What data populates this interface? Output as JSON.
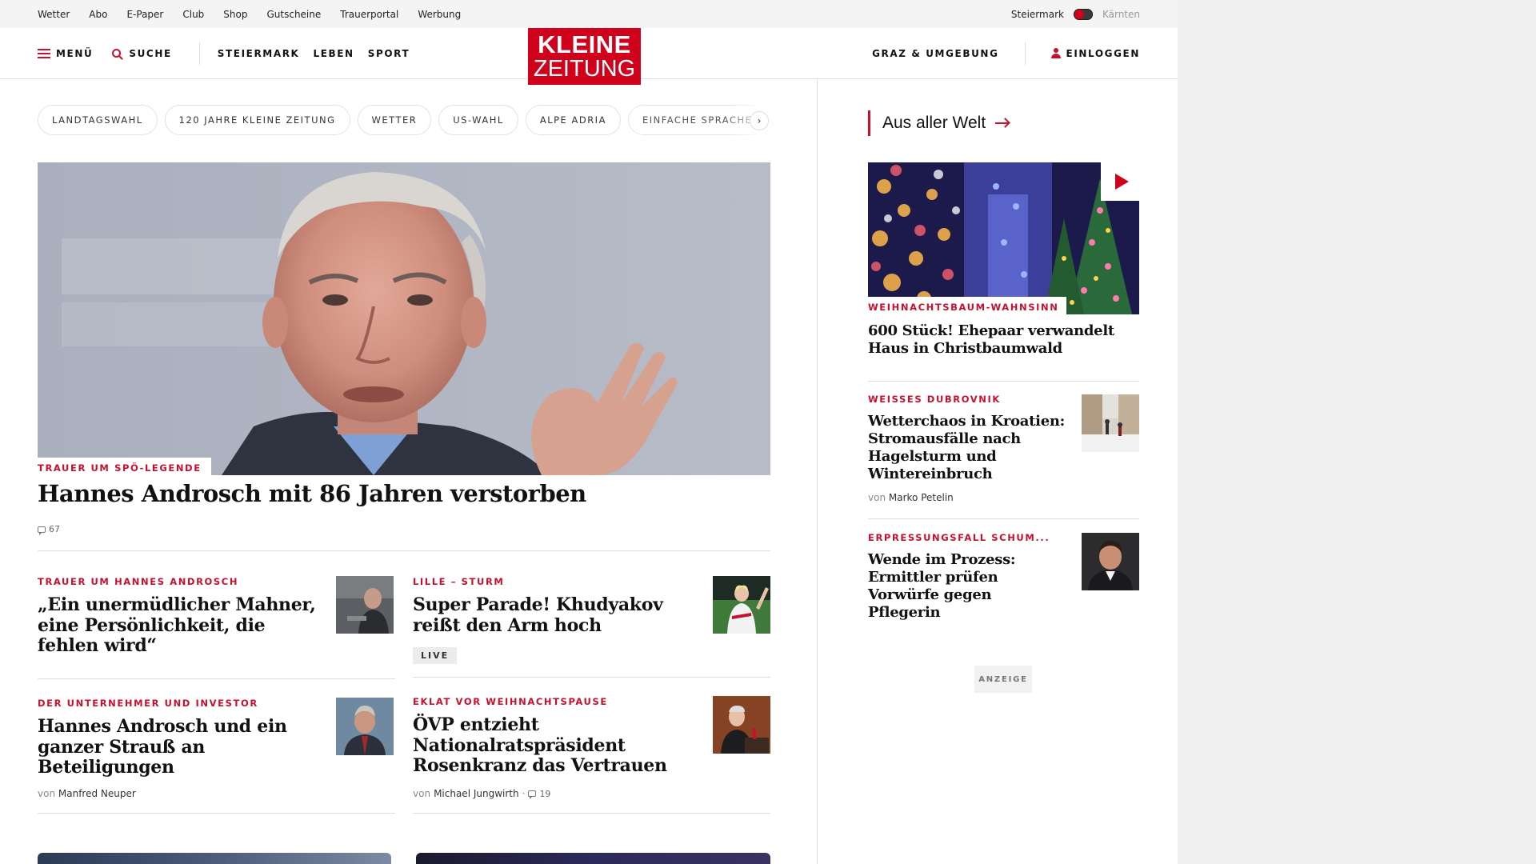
{
  "utility": {
    "links": [
      "Wetter",
      "Abo",
      "E-Paper",
      "Club",
      "Shop",
      "Gutscheine",
      "Trauerportal",
      "Werbung"
    ],
    "region_active": "Steiermark",
    "region_inactive": "Kärnten"
  },
  "nav": {
    "menu": "MENÜ",
    "search": "SUCHE",
    "sections": [
      "STEIERMARK",
      "LEBEN",
      "SPORT"
    ],
    "local": "GRAZ & UMGEBUNG",
    "login": "EINLOGGEN",
    "logo_line1": "KLEINE",
    "logo_line2": "ZEITUNG"
  },
  "chips": [
    "LANDTAGSWAHL",
    "120 JAHRE KLEINE ZEITUNG",
    "WETTER",
    "US-WAHL",
    "ALPE ADRIA",
    "EINFACHE SPRACHE"
  ],
  "hero": {
    "kicker": "TRAUER UM SPÖ-LEGENDE",
    "title": "Hannes Androsch mit 86 Jahren verstorben",
    "comments": "67"
  },
  "articles": [
    {
      "kicker": "TRAUER UM HANNES ANDROSCH",
      "title": "„Ein unermüdlicher Mahner, eine Persönlichkeit, die fehlen wird“"
    },
    {
      "kicker": "LILLE – STURM",
      "title": "Super Parade! Khudyakov reißt den Arm hoch",
      "badge": "LIVE"
    },
    {
      "kicker": "DER UNTERNEHMER UND INVESTOR",
      "title": "Hannes Androsch und ein ganzer Strauß an Beteiligungen",
      "by_prefix": "von",
      "author": "Manfred Neuper"
    },
    {
      "kicker": "EKLAT VOR WEIHNACHTSPAUSE",
      "title": "ÖVP entzieht Nationalratspräsident Rosenkranz das Vertrauen",
      "by_prefix": "von",
      "author": "Michael Jungwirth",
      "comments": "19"
    }
  ],
  "sidebar": {
    "title": "Aus aller Welt",
    "items": [
      {
        "kicker": "WEIHNACHTSBAUM-WAHNSINN",
        "title": "600 Stück! Ehepaar verwandelt Haus in Christbaumwald"
      },
      {
        "kicker": "WEISSES DUBROVNIK",
        "title": "Wetterchaos in Kroatien: Stromausfälle nach Hagelsturm und Wintereinbruch",
        "by_prefix": "von",
        "author": "Marko Petelin"
      },
      {
        "kicker": "ERPRESSUNGSFALL SCHUM...",
        "title": "Wende im Prozess: Ermittler prüfen Vorwürfe gegen Pflegerin"
      }
    ],
    "ad_label": "ANZEIGE"
  },
  "colors": {
    "brand_red": "#d0021b",
    "kicker_red": "#c8102e"
  },
  "icons": [
    "menu-icon",
    "search-icon",
    "user-icon",
    "chevron-right-icon",
    "arrow-right-icon",
    "play-icon",
    "comment-icon"
  ]
}
